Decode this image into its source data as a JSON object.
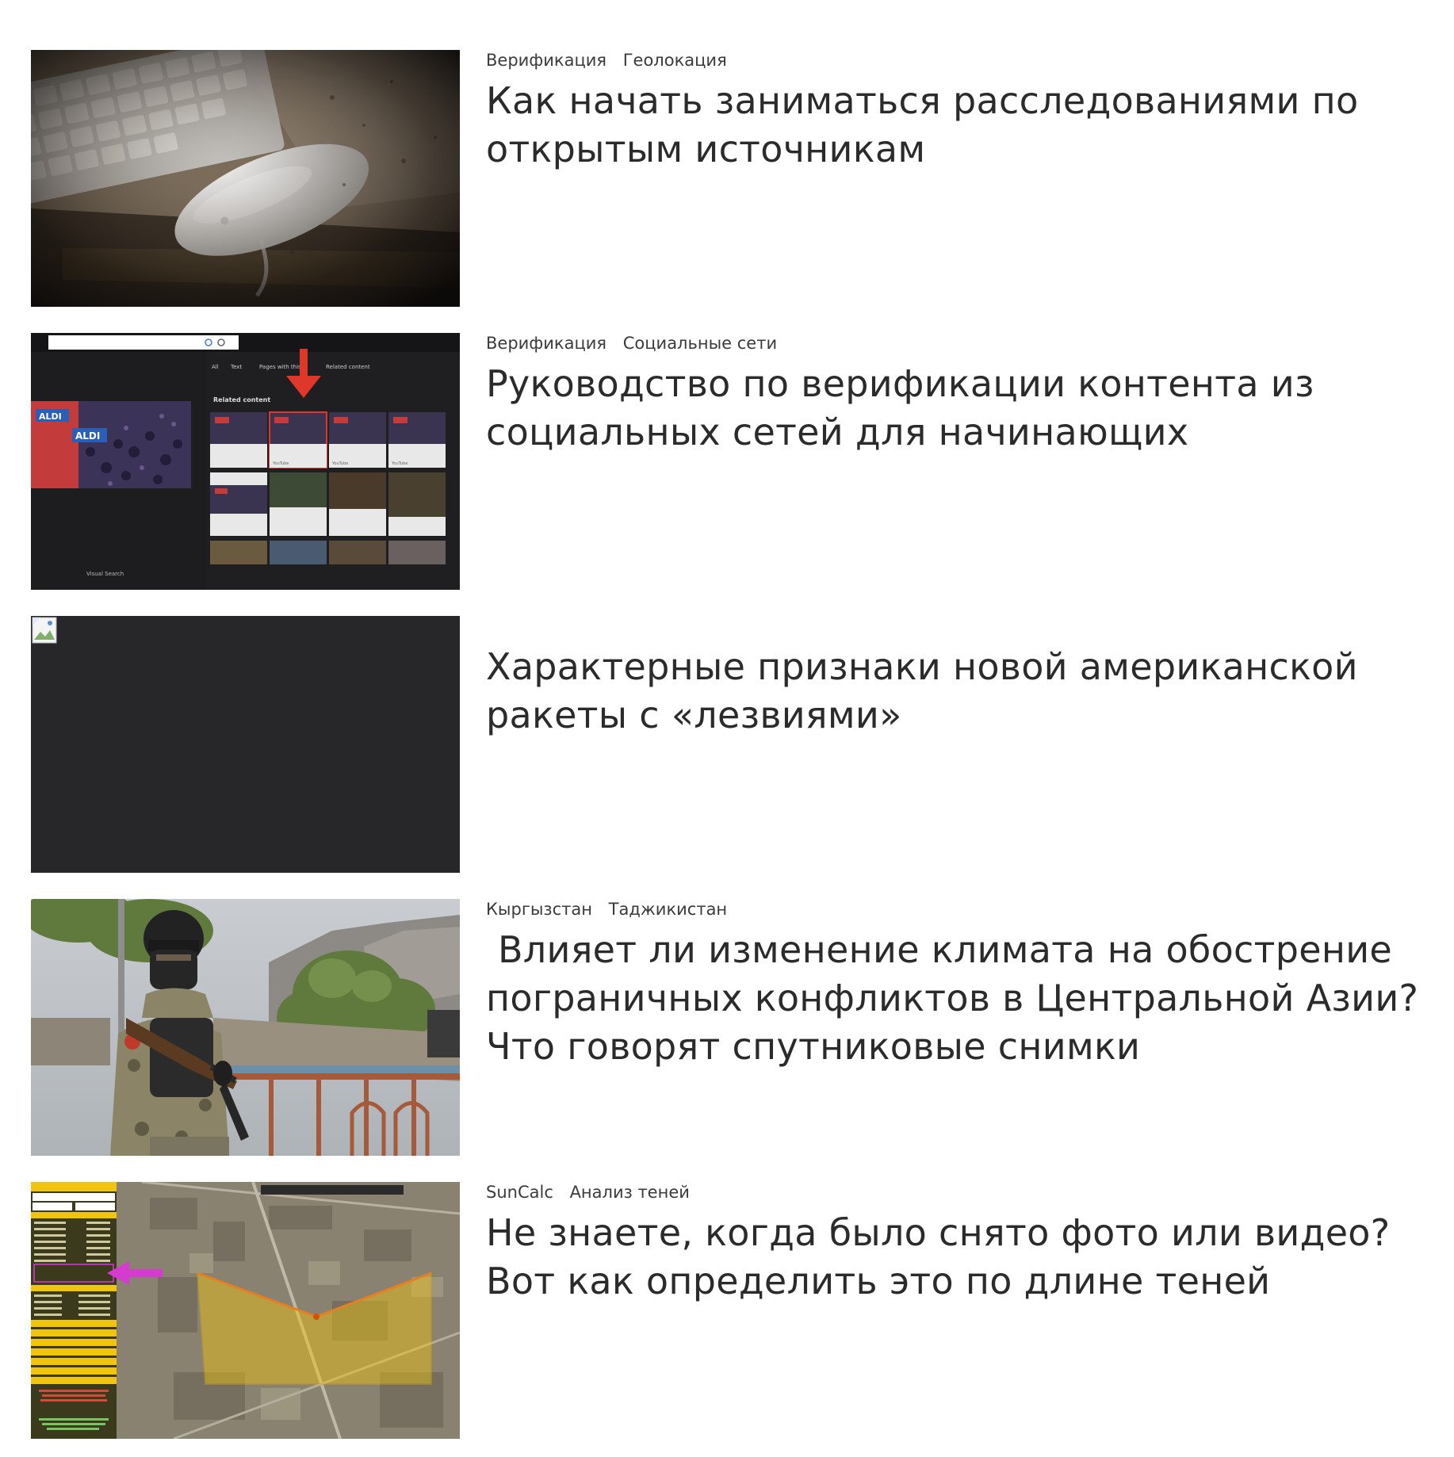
{
  "articles": [
    {
      "tags": [
        "Верификация",
        "Геолокация"
      ],
      "title": "Как начать заниматься расследованиями по открытым источникам",
      "thumb_icon": "keyboard-mouse-photo"
    },
    {
      "tags": [
        "Верификация",
        "Социальные сети"
      ],
      "title": "Руководство по верификации контента из социальных сетей для начинающих",
      "thumb_icon": "search-results-screenshot",
      "thumb_text": {
        "brand_top": "ALDI",
        "brand_mid": "ALDI",
        "related": "Related content",
        "tab_all": "All",
        "tab_text": "Text",
        "tab_pages": "Pages with this",
        "tab_related": "Related content",
        "visual": "Visual Search",
        "youtube": "YouTube"
      }
    },
    {
      "tags": [],
      "title": "Характерные признаки новой американской ракеты с «лезвиями»",
      "thumb_icon": "broken-image-icon"
    },
    {
      "tags": [
        "Кыргызстан",
        "Таджикистан"
      ],
      "title": " Влияет ли изменение климата на обострение пограничных конфликтов в Центральной Азии? Что говорят спутниковые снимки",
      "thumb_icon": "soldier-photo"
    },
    {
      "tags": [
        "SunCalc",
        "Анализ теней"
      ],
      "title": "Не знаете, когда было снято фото или видео? Вот как определить это по длине теней",
      "thumb_icon": "suncalc-map-screenshot"
    }
  ],
  "colors": {
    "text": "#2b2b2b",
    "tag_text": "#3b3b3b",
    "dark_placeholder": "#27272a",
    "arrow_red": "#e0372b",
    "suncalc_yellow": "#f1c40f",
    "suncalc_arrow": "#d63bd0"
  }
}
